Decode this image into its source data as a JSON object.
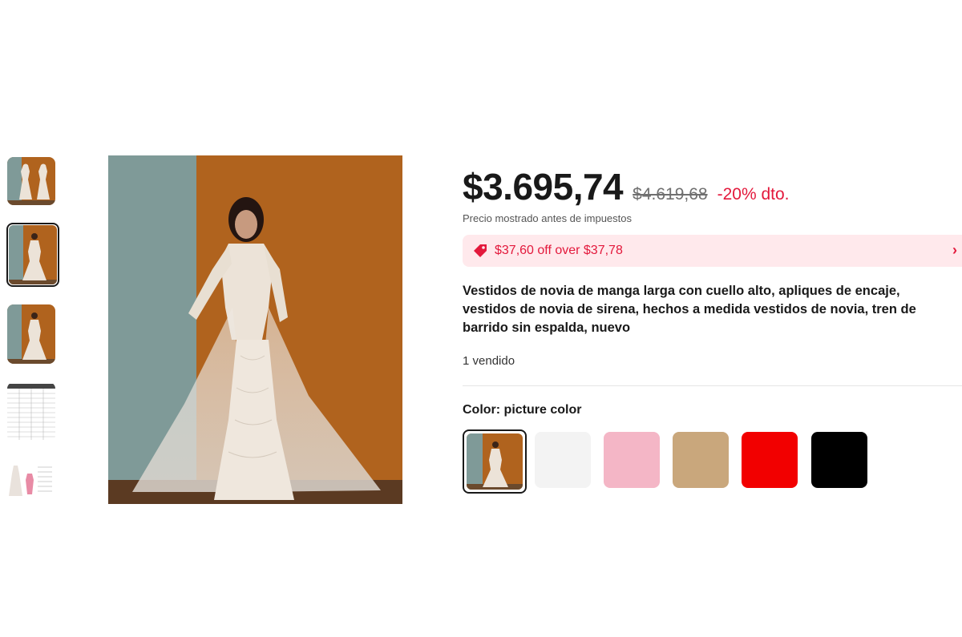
{
  "product": {
    "price": "$3.695,74",
    "old_price": "$4.619,68",
    "discount": "-20% dto.",
    "tax_note": "Precio mostrado antes de impuestos",
    "coupon": {
      "text": "$37,60 off over $37,78",
      "icon": "tag-icon",
      "chevron": "›"
    },
    "title": "Vestidos de novia de manga larga con cuello alto, apliques de encaje, vestidos de novia de sirena, hechos a medida vestidos de novia, tren de barrido sin espalda, nuevo",
    "sold": "1 vendido",
    "color_label": "Color:",
    "color_value": " picture color"
  },
  "gallery": {
    "selected_index": 1,
    "thumbnails": [
      "photo",
      "photo",
      "photo",
      "size-chart",
      "measure-guide"
    ]
  },
  "swatches": [
    {
      "name": "picture color",
      "color": "#b0631e",
      "selected": true
    },
    {
      "name": "white",
      "color": "#f3f3f3"
    },
    {
      "name": "pink",
      "color": "#f4b6c6"
    },
    {
      "name": "champagne",
      "color": "#c9a77c"
    },
    {
      "name": "red",
      "color": "#f20000"
    },
    {
      "name": "black",
      "color": "#000000"
    }
  ],
  "colors": {
    "accent_red": "#e3193c",
    "coupon_bg": "#ffe9ec"
  }
}
